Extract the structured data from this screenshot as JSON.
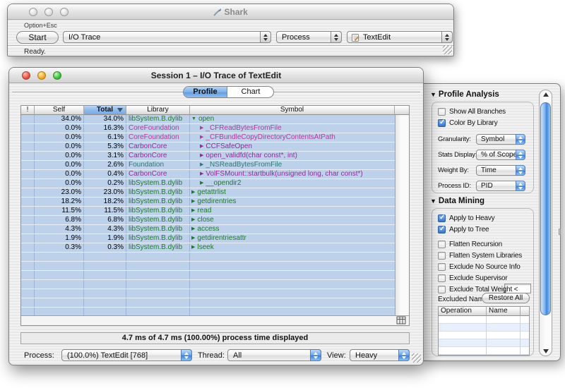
{
  "shark_window": {
    "title": "Shark",
    "shortcut_hint": "Option+Esc",
    "start_button": "Start",
    "config_select": "I/O Trace",
    "target_type_select": "Process",
    "target_select": "TextEdit",
    "status": "Ready."
  },
  "session_window": {
    "title": "Session 1 – I/O Trace of TextEdit",
    "tabs": [
      {
        "label": "Profile",
        "selected": true
      },
      {
        "label": "Chart",
        "selected": false
      }
    ],
    "table": {
      "columns": [
        "!",
        "Self",
        "Total",
        "Library",
        "Symbol"
      ],
      "sort_column": "Total",
      "rows": [
        {
          "self": "34.0%",
          "total": "34.0%",
          "library": "libSystem.B.dylib",
          "symbol": "open",
          "level": 0,
          "expanded": true,
          "color": "green"
        },
        {
          "self": "0.0%",
          "total": "16.3%",
          "library": "CoreFoundation",
          "symbol": "_CFReadBytesFromFile",
          "level": 1,
          "expanded": false,
          "color": "magenta"
        },
        {
          "self": "0.0%",
          "total": "6.1%",
          "library": "CoreFoundation",
          "symbol": "_CFBundleCopyDirectoryContentsAtPath",
          "level": 1,
          "expanded": false,
          "color": "magenta"
        },
        {
          "self": "0.0%",
          "total": "5.3%",
          "library": "CarbonCore",
          "symbol": "CCFSafeOpen",
          "level": 1,
          "expanded": false,
          "color": "purple"
        },
        {
          "self": "0.0%",
          "total": "3.1%",
          "library": "CarbonCore",
          "symbol": "open_validfd(char const*, int)",
          "level": 1,
          "expanded": false,
          "color": "purple"
        },
        {
          "self": "0.0%",
          "total": "2.6%",
          "library": "Foundation",
          "symbol": "_NSReadBytesFromFile",
          "level": 1,
          "expanded": false,
          "color": "teal"
        },
        {
          "self": "0.0%",
          "total": "0.4%",
          "library": "CarbonCore",
          "symbol": "VolFSMount::startbulk(unsigned long, char const*)",
          "level": 1,
          "expanded": false,
          "color": "purple"
        },
        {
          "self": "0.0%",
          "total": "0.2%",
          "library": "libSystem.B.dylib",
          "symbol": "__opendir2",
          "level": 1,
          "expanded": false,
          "color": "green"
        },
        {
          "self": "23.0%",
          "total": "23.0%",
          "library": "libSystem.B.dylib",
          "symbol": "getattrlist",
          "level": 0,
          "expanded": false,
          "color": "green"
        },
        {
          "self": "18.2%",
          "total": "18.2%",
          "library": "libSystem.B.dylib",
          "symbol": "getdirentries",
          "level": 0,
          "expanded": false,
          "color": "green"
        },
        {
          "self": "11.5%",
          "total": "11.5%",
          "library": "libSystem.B.dylib",
          "symbol": "read",
          "level": 0,
          "expanded": false,
          "color": "green"
        },
        {
          "self": "6.8%",
          "total": "6.8%",
          "library": "libSystem.B.dylib",
          "symbol": "close",
          "level": 0,
          "expanded": false,
          "color": "green"
        },
        {
          "self": "4.3%",
          "total": "4.3%",
          "library": "libSystem.B.dylib",
          "symbol": "access",
          "level": 0,
          "expanded": false,
          "color": "green"
        },
        {
          "self": "1.9%",
          "total": "1.9%",
          "library": "libSystem.B.dylib",
          "symbol": "getdirentriesattr",
          "level": 0,
          "expanded": false,
          "color": "green"
        },
        {
          "self": "0.3%",
          "total": "0.3%",
          "library": "libSystem.B.dylib",
          "symbol": "lseek",
          "level": 0,
          "expanded": false,
          "color": "green"
        }
      ],
      "empty_rows": 7
    },
    "status_bar": "4.7 ms of 4.7 ms (100.00%) process time displayed",
    "footer": {
      "process_label": "Process:",
      "process_value": "(100.0%) TextEdit [768]",
      "thread_label": "Thread:",
      "thread_value": "All",
      "view_label": "View:",
      "view_value": "Heavy"
    }
  },
  "drawer": {
    "profile_analysis": {
      "title": "Profile Analysis",
      "checkboxes": [
        {
          "label": "Show All Branches",
          "checked": false
        },
        {
          "label": "Color By Library",
          "checked": true
        }
      ],
      "popups": [
        {
          "label": "Granularity:",
          "value": "Symbol"
        },
        {
          "label": "Stats Display:",
          "value": "% of Scope"
        },
        {
          "label": "Weight By:",
          "value": "Time"
        },
        {
          "label": "Process ID:",
          "value": "PID"
        }
      ]
    },
    "data_mining": {
      "title": "Data Mining",
      "checkboxes_top": [
        {
          "label": "Apply to Heavy",
          "checked": true
        },
        {
          "label": "Apply to Tree",
          "checked": true
        }
      ],
      "checkboxes_filters": [
        {
          "label": "Flatten Recursion",
          "checked": false
        },
        {
          "label": "Flatten System Libraries",
          "checked": false
        },
        {
          "label": "Exclude No Source Info",
          "checked": false
        },
        {
          "label": "Exclude Supervisor",
          "checked": false
        },
        {
          "label": "Exclude Total Weight <",
          "checked": false
        }
      ],
      "exclude_weight_field_value": "",
      "excluded_names_label": "Excluded Names",
      "restore_all_button": "Restore All",
      "table_columns": [
        "Operation",
        "Name"
      ]
    }
  },
  "colors": {
    "library_text": {
      "green": "#1e7a2e",
      "magenta": "#b23a9c",
      "purple": "#8e2d96",
      "teal": "#2a7a72"
    },
    "row_blue": "#bdd1ea",
    "sorted_header_blue": "#8ebaec",
    "aqua_blue": "#3f7fd6"
  }
}
